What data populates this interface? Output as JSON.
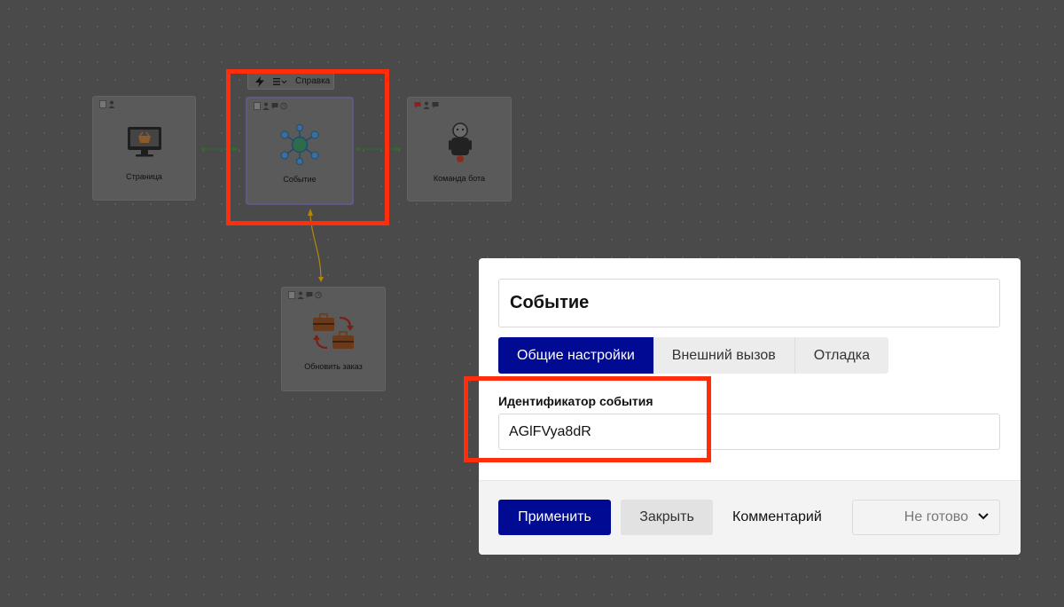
{
  "canvas": {
    "nodes": [
      {
        "id": "page",
        "label": "Страница",
        "icon": "monitor-basket-icon"
      },
      {
        "id": "event",
        "label": "Событие",
        "icon": "network-hub-icon",
        "selected": true
      },
      {
        "id": "bot-command",
        "label": "Команда бота",
        "icon": "robot-icon"
      },
      {
        "id": "update-order",
        "label": "Обновить заказ",
        "icon": "briefcase-swap-icon"
      }
    ],
    "toolbar": {
      "help_label": "Справка",
      "icons": [
        "lightning-icon",
        "menu-dropdown-icon"
      ]
    }
  },
  "modal": {
    "title": "Событие",
    "tabs": [
      {
        "label": "Общие настройки",
        "active": true
      },
      {
        "label": "Внешний вызов",
        "active": false
      },
      {
        "label": "Отладка",
        "active": false
      }
    ],
    "field": {
      "label": "Идентификатор события",
      "value": "AGlFVya8dR"
    },
    "footer": {
      "apply_label": "Применить",
      "close_label": "Закрыть",
      "comment_label": "Комментарий",
      "status_value": "Не готово"
    }
  },
  "colors": {
    "primary": "#000a93",
    "highlight": "#ff2d0c",
    "canvas_bg": "#4a4a4a",
    "connector_green": "#2e6b2e",
    "connector_orange": "#b8860b"
  }
}
